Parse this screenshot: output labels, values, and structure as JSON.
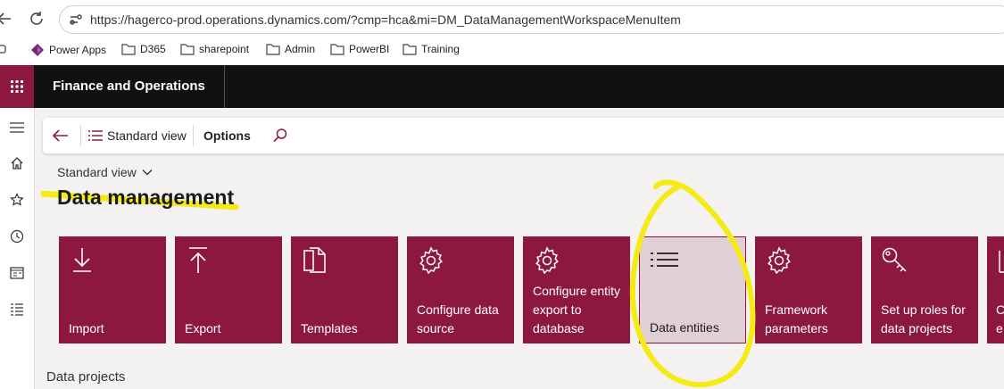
{
  "browser": {
    "url": "https://hagerco-prod.operations.dynamics.com/?cmp=hca&mi=DM_DataManagementWorkspaceMenuItem",
    "bookmarks": [
      "Power Apps",
      "D365",
      "sharepoint",
      "Admin",
      "PowerBI",
      "Training"
    ]
  },
  "app": {
    "title": "Finance and Operations"
  },
  "actionbar": {
    "view_label": "Standard view",
    "options_label": "Options"
  },
  "page": {
    "view_selector": "Standard view",
    "title": "Data management",
    "section_peek": "Data projects"
  },
  "tiles": [
    {
      "label": "Import",
      "icon": "import-arrow-icon"
    },
    {
      "label": "Export",
      "icon": "export-arrow-icon"
    },
    {
      "label": "Templates",
      "icon": "templates-icon"
    },
    {
      "label": "Configure data source",
      "icon": "gear-icon"
    },
    {
      "label": "Configure entity export to database",
      "icon": "gear-icon"
    },
    {
      "label": "Data entities",
      "icon": "list-icon"
    },
    {
      "label": "Framework parameters",
      "icon": "gear-icon"
    },
    {
      "label": "Set up roles for data projects",
      "icon": "key-icon"
    },
    {
      "label": "C e",
      "icon": "chart-icon"
    }
  ],
  "colors": {
    "brand": "#8c1842",
    "selected_tile": "#e0cfd5",
    "appbar": "#111111",
    "annotation": "#f5ea14"
  }
}
